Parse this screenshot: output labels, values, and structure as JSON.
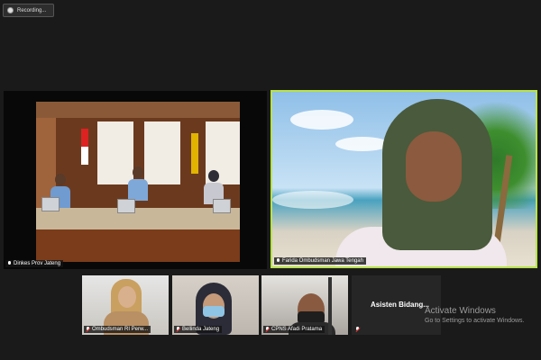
{
  "recording": {
    "label": "Recording..."
  },
  "tiles": [
    {
      "name": "Dinkes Prov Jateng",
      "muted": false
    },
    {
      "name": "Farida Ombudsman Jawa Tengah",
      "muted": false,
      "active": true
    },
    {
      "name": "Ombudsman RI  Perw...",
      "muted": true
    },
    {
      "name": "Bellinda Jateng",
      "muted": true
    },
    {
      "name": "CPNS Afadi Pratama",
      "muted": true
    },
    {
      "name": "Asisten  Bidang...",
      "muted": true
    }
  ],
  "watermark": {
    "title": "Activate Windows",
    "subtitle": "Go to Settings to activate Windows."
  },
  "colors": {
    "active_border": "#b8e34a",
    "background": "#1a1a1a"
  }
}
